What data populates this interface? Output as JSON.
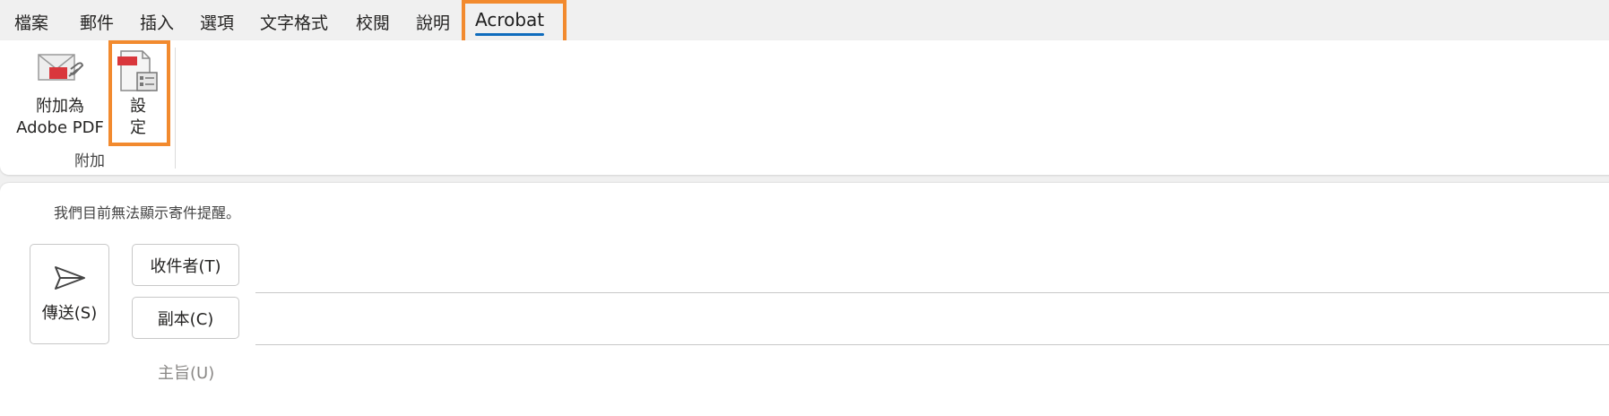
{
  "tabs": [
    {
      "label": "檔案"
    },
    {
      "label": "郵件"
    },
    {
      "label": "插入"
    },
    {
      "label": "選項"
    },
    {
      "label": "文字格式"
    },
    {
      "label": "校閱"
    },
    {
      "label": "說明"
    },
    {
      "label": "Acrobat",
      "active": true
    }
  ],
  "ribbon": {
    "attach_pdf_label_line1": "附加為",
    "attach_pdf_label_line2": "Adobe PDF",
    "settings_label_line1": "設",
    "settings_label_line2": "定",
    "group_label": "附加"
  },
  "compose": {
    "notice": "我們目前無法顯示寄件提醒。",
    "send_label": "傳送(S)",
    "to_label": "收件者(T)",
    "cc_label": "副本(C)",
    "subject_placeholder": "主旨(U)"
  },
  "colors": {
    "highlight": "#f28a2e",
    "active_tab_underline": "#0f6cbd"
  },
  "icons": [
    "attach-as-pdf-icon",
    "settings-icon",
    "send-icon"
  ]
}
